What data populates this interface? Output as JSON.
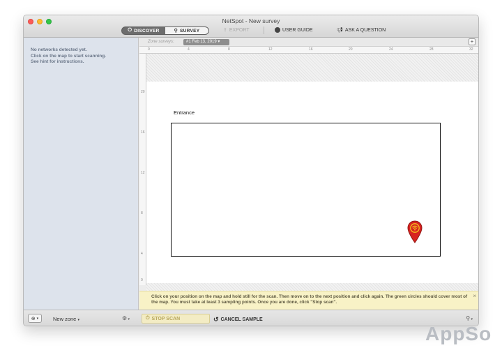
{
  "window": {
    "title": "NetSpot - New survey"
  },
  "toolbar": {
    "discover_label": "DISCOVER",
    "survey_label": "SURVEY",
    "export_label": "EXPORT",
    "user_guide_label": "USER GUIDE",
    "ask_question_label": "ASK A QUESTION"
  },
  "sidebar": {
    "message": "No networks detected yet.\nClick on the map to start scanning.\nSee hint for instructions."
  },
  "zone": {
    "label": "Zone surveys:",
    "selected": "#1 Feb 13, 2019",
    "add_symbol": "+"
  },
  "ruler": {
    "top_ticks": [
      "0",
      "4",
      "8",
      "12",
      "16",
      "20",
      "24",
      "28",
      "32"
    ],
    "left_ticks": [
      "20",
      "16",
      "12",
      "8",
      "4",
      "0"
    ]
  },
  "map": {
    "label": "Entrance"
  },
  "hint": {
    "text": "Click on your position on the map and hold still for the scan. Then move on to the next position and click again. The green circles should cover most of the map. You must take at least 3 sampling points. Once you are done, click \"Stop scan\".",
    "close_symbol": "×"
  },
  "bottom": {
    "add_symbol": "⊕",
    "zone_name": "New zone",
    "stop_scan_label": "STOP SCAN",
    "cancel_sample_label": "CANCEL SAMPLE"
  },
  "watermark": "AppSo",
  "colors": {
    "sidebar_bg": "#dde3ec",
    "hint_bg": "#f8f2c6",
    "pin_red": "#d8231f",
    "segment_dark": "#6d6d6d"
  },
  "icons": [
    "power-icon",
    "location-pin-icon",
    "export-icon",
    "help-circle-icon",
    "megaphone-icon",
    "plus-icon",
    "gear-icon",
    "stop-icon",
    "undo-icon",
    "map-pin-icon",
    "close-icon"
  ]
}
